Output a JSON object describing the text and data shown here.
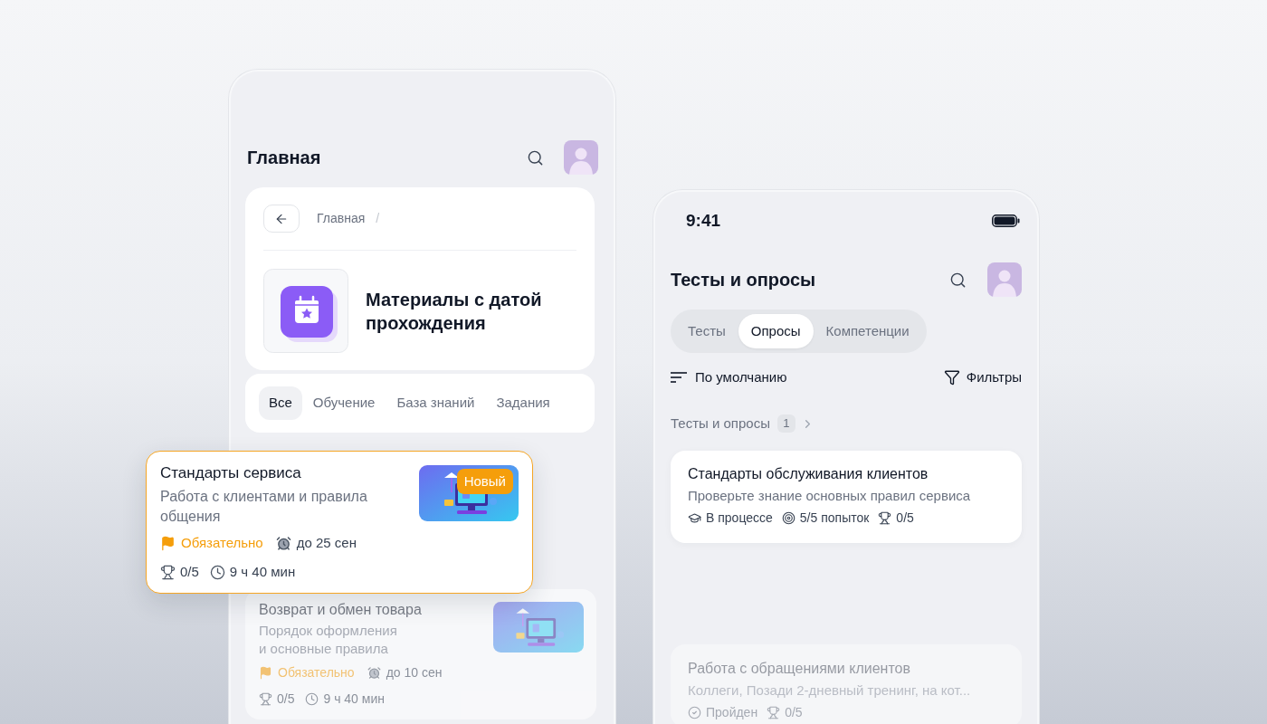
{
  "left_screen": {
    "header": {
      "title": "Главная"
    },
    "breadcrumb": {
      "items": [
        {
          "label": "Главная"
        }
      ],
      "separator": "/"
    },
    "section": {
      "title": "Материалы с датой прохождения"
    },
    "tabs": [
      {
        "label": "Все",
        "selected": true
      },
      {
        "label": "Обучение",
        "selected": false
      },
      {
        "label": "База знаний",
        "selected": false
      },
      {
        "label": "Задания",
        "selected": false
      }
    ],
    "courses": [
      {
        "title": "Стандарты сервиса",
        "description": "Работа с клиентами и правила общения",
        "highlighted": true,
        "dimmed": false,
        "badge": "Новый",
        "required": "Обязательно",
        "deadline": "до 25 сен",
        "score": "0/5",
        "duration": "9 ч 40 мин"
      },
      {
        "title": "Возврат и обмен товара",
        "description": "Порядок оформления и основные правила",
        "highlighted": false,
        "dimmed": true,
        "required": "Обязательно",
        "deadline": "до 10 сен",
        "score": "0/5",
        "duration": "9 ч 40 мин"
      }
    ]
  },
  "right_screen": {
    "status_bar": {
      "time": "9:41"
    },
    "header": {
      "title": "Тесты и опросы"
    },
    "tabs": [
      {
        "label": "Тесты",
        "selected": false
      },
      {
        "label": "Опросы",
        "selected": true
      },
      {
        "label": "Компетенции",
        "selected": false
      }
    ],
    "sort": {
      "label": "По умолчанию"
    },
    "filter": {
      "label": "Фильтры"
    },
    "section": {
      "title": "Тесты и опросы",
      "count": "1"
    },
    "tests": [
      {
        "title": "Стандарты обслуживания клиентов",
        "description": "Проверьте знание основных правил сервиса",
        "dimmed": false,
        "meta": [
          {
            "kind": "status",
            "text": "В процессе"
          },
          {
            "kind": "attempts",
            "text": "5/5 попыток"
          },
          {
            "kind": "score",
            "text": "0/5"
          }
        ]
      },
      {
        "title": "Работа с обращениями клиентов",
        "description": "Коллеги, Позади 2-дневный тренинг, на кот...",
        "dimmed": true,
        "meta": [
          {
            "kind": "passed",
            "text": "Пройден"
          },
          {
            "kind": "score",
            "text": "0/5"
          }
        ]
      }
    ]
  }
}
